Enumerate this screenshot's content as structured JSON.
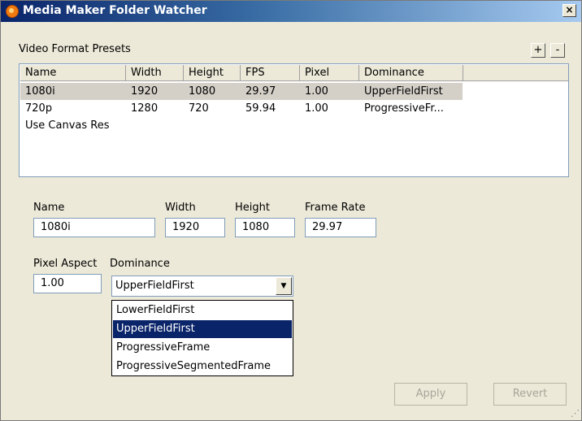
{
  "window": {
    "title": "Media Maker Folder Watcher",
    "close_label": "×"
  },
  "presets": {
    "section_label": "Video Format Presets",
    "add_label": "+",
    "remove_label": "-",
    "columns": [
      "Name",
      "Width",
      "Height",
      "FPS",
      "Pixel",
      "Dominance"
    ],
    "rows": [
      {
        "name": "1080i",
        "width": "1920",
        "height": "1080",
        "fps": "29.97",
        "pixel": "1.00",
        "dominance": "UpperFieldFirst",
        "selected": true
      },
      {
        "name": "720p",
        "width": "1280",
        "height": "720",
        "fps": "59.94",
        "pixel": "1.00",
        "dominance": "ProgressiveFr...",
        "selected": false
      },
      {
        "name": "Use Canvas Res",
        "width": "",
        "height": "",
        "fps": "",
        "pixel": "",
        "dominance": "",
        "selected": false
      }
    ]
  },
  "form": {
    "name_label": "Name",
    "name_value": "1080i",
    "width_label": "Width",
    "width_value": "1920",
    "height_label": "Height",
    "height_value": "1080",
    "frame_rate_label": "Frame Rate",
    "frame_rate_value": "29.97",
    "pixel_aspect_label": "Pixel Aspect",
    "pixel_aspect_value": "1.00",
    "dominance_label": "Dominance",
    "dominance_value": "UpperFieldFirst",
    "dominance_options": [
      "LowerFieldFirst",
      "UpperFieldFirst",
      "ProgressiveFrame",
      "ProgressiveSegmentedFrame"
    ],
    "dominance_highlighted": "UpperFieldFirst"
  },
  "buttons": {
    "apply_label": "Apply",
    "revert_label": "Revert"
  }
}
